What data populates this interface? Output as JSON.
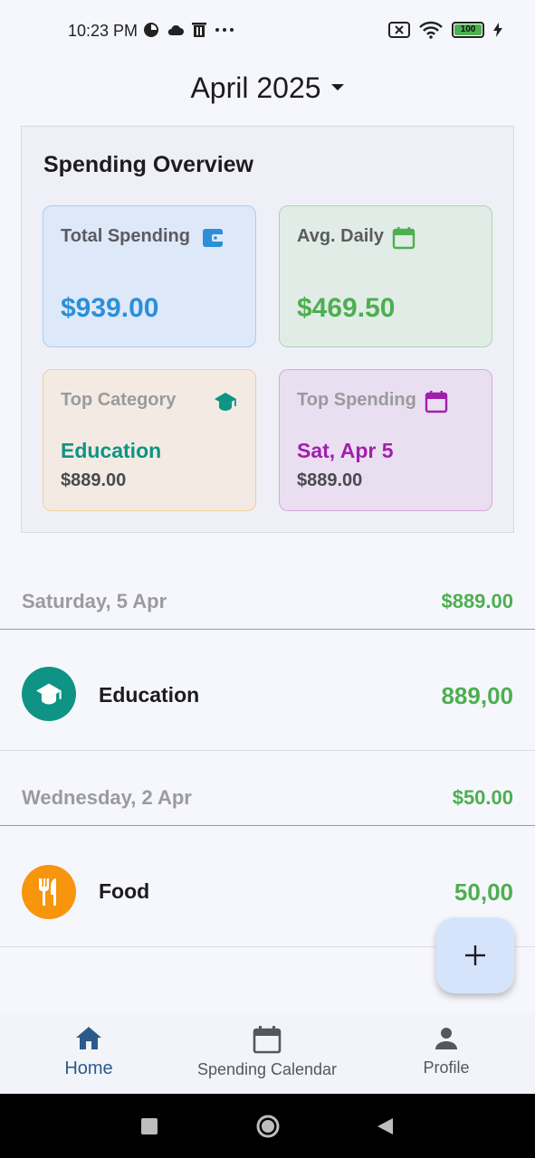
{
  "status_bar": {
    "time": "10:23 PM",
    "battery": "100"
  },
  "header": {
    "month": "April 2025"
  },
  "overview": {
    "title": "Spending Overview",
    "total": {
      "label": "Total Spending",
      "value": "$939.00",
      "icon": "wallet-icon"
    },
    "avg": {
      "label": "Avg. Daily",
      "value": "$469.50",
      "icon": "calendar-icon"
    },
    "top_category": {
      "label": "Top Category",
      "name": "Education",
      "amount": "$889.00",
      "icon": "school-icon"
    },
    "top_spending": {
      "label": "Top Spending",
      "name": "Sat, Apr 5",
      "amount": "$889.00",
      "icon": "calendar-icon"
    }
  },
  "days": [
    {
      "label": "Saturday, 5 Apr",
      "total": "$889.00",
      "transactions": [
        {
          "name": "Education",
          "amount": "889,00",
          "icon": "school-icon",
          "color": "#0e9384"
        }
      ]
    },
    {
      "label": "Wednesday, 2 Apr",
      "total": "$50.00",
      "transactions": [
        {
          "name": "Food",
          "amount": "50,00",
          "icon": "restaurant-icon",
          "color": "#f7950c"
        }
      ]
    }
  ],
  "fab": {
    "label": "+"
  },
  "nav": {
    "items": [
      {
        "label": "Home",
        "icon": "home-icon"
      },
      {
        "label": "Spending Calendar",
        "icon": "calendar-icon"
      },
      {
        "label": "Profile",
        "icon": "person-icon"
      }
    ],
    "active": "Home"
  },
  "colors": {
    "accent_blue": "#2d8fd8",
    "accent_green": "#4caf50",
    "accent_teal": "#0e9384",
    "accent_purple": "#a11fad",
    "nav_active": "#2b5b8c"
  }
}
